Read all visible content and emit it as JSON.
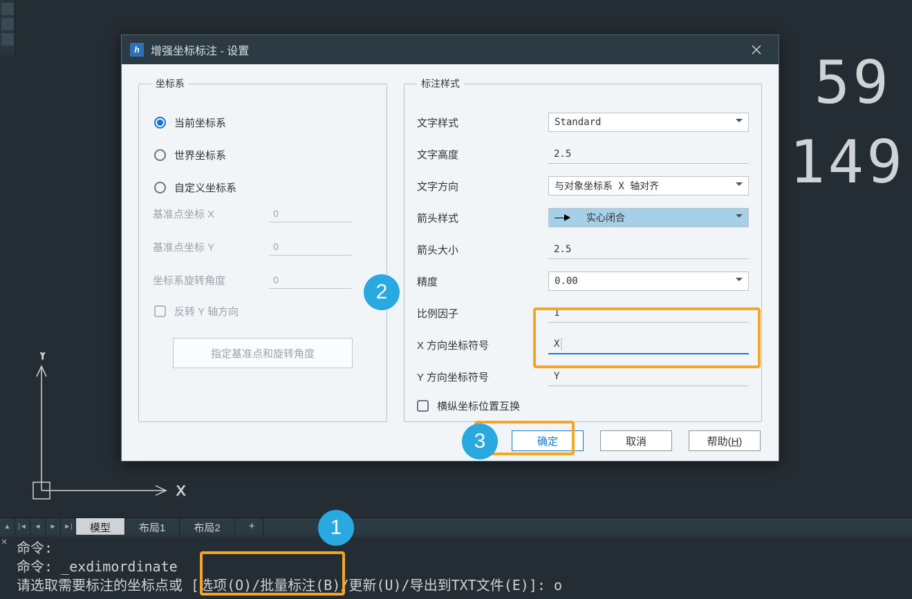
{
  "dialog": {
    "title": "增强坐标标注 - 设置",
    "coord_system": {
      "legend": "坐标系",
      "opt_current": "当前坐标系",
      "opt_world": "世界坐标系",
      "opt_custom": "自定义坐标系",
      "base_x_label": "基准点坐标 X",
      "base_x_value": "0",
      "base_y_label": "基准点坐标 Y",
      "base_y_value": "0",
      "rot_label": "坐标系旋转角度",
      "rot_value": "0",
      "flip_y": "反转 Y 轴方向",
      "pick_btn": "指定基准点和旋转角度"
    },
    "style": {
      "legend": "标注样式",
      "text_style_label": "文字样式",
      "text_style_value": "Standard",
      "text_height_label": "文字高度",
      "text_height_value": "2.5",
      "text_dir_label": "文字方向",
      "text_dir_value": "与对象坐标系 X 轴对齐",
      "arrow_style_label": "箭头样式",
      "arrow_style_value": "实心闭合",
      "arrow_size_label": "箭头大小",
      "arrow_size_value": "2.5",
      "precision_label": "精度",
      "precision_value": "0.00",
      "scale_label": "比例因子",
      "scale_value": "1",
      "x_sym_label": "X 方向坐标符号",
      "x_sym_value": "X",
      "y_sym_label": "Y 方向坐标符号",
      "y_sym_value": "Y",
      "swap_label": "横纵坐标位置互换"
    },
    "buttons": {
      "ok": "确定",
      "cancel": "取消",
      "help": "帮助(",
      "help_u": "H",
      "help_tail": ")"
    }
  },
  "callouts": {
    "c1": "1",
    "c2": "2",
    "c3": "3"
  },
  "bg": {
    "num_top": "59",
    "num_bot": "149"
  },
  "ucs": {
    "x": "X",
    "y": "Y"
  },
  "tabs": {
    "model": "模型",
    "layout1": "布局1",
    "layout2": "布局2",
    "plus": "+"
  },
  "cmd": {
    "prefix1": "命令: ",
    "prefix2": "命令: ",
    "cmd_name": "_exdimordinate",
    "prompt": "请选取需要标注的坐标点或 [选项(O)/批量标注(B)/更新(U)/导出到TXT文件(E)]: ",
    "input": "o"
  }
}
